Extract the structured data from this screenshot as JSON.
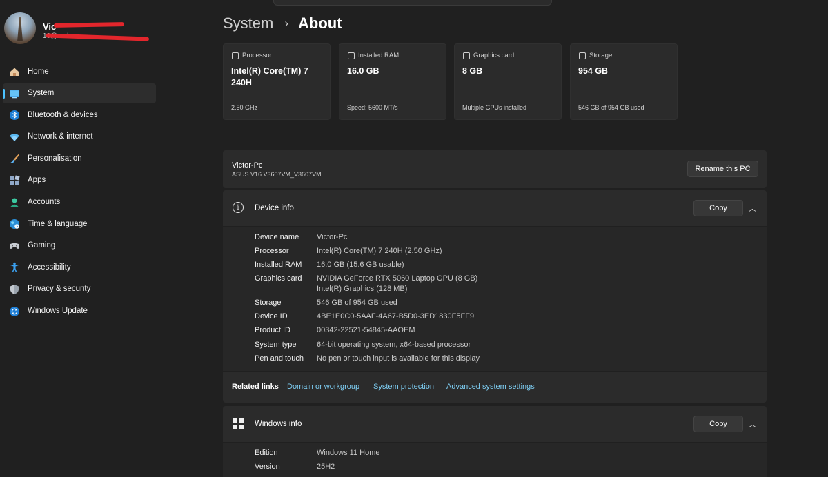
{
  "profile": {
    "name": "Vic",
    "email": "10@outlo"
  },
  "sidebar": {
    "items": [
      {
        "label": "Home",
        "icon": "home-icon",
        "active": false
      },
      {
        "label": "System",
        "icon": "system-icon",
        "active": true
      },
      {
        "label": "Bluetooth & devices",
        "icon": "bluetooth-icon",
        "active": false
      },
      {
        "label": "Network & internet",
        "icon": "wifi-icon",
        "active": false
      },
      {
        "label": "Personalisation",
        "icon": "brush-icon",
        "active": false
      },
      {
        "label": "Apps",
        "icon": "apps-icon",
        "active": false
      },
      {
        "label": "Accounts",
        "icon": "accounts-icon",
        "active": false
      },
      {
        "label": "Time & language",
        "icon": "globe-icon",
        "active": false
      },
      {
        "label": "Gaming",
        "icon": "gamepad-icon",
        "active": false
      },
      {
        "label": "Accessibility",
        "icon": "accessibility-icon",
        "active": false
      },
      {
        "label": "Privacy & security",
        "icon": "shield-icon",
        "active": false
      },
      {
        "label": "Windows Update",
        "icon": "update-icon",
        "active": false
      }
    ]
  },
  "breadcrumb": {
    "parent": "System",
    "separator": "›",
    "current": "About"
  },
  "cards": [
    {
      "label": "Processor",
      "value": "Intel(R) Core(TM) 7 240H",
      "sub": "2.50 GHz"
    },
    {
      "label": "Installed RAM",
      "value": "16.0 GB",
      "sub": "Speed: 5600 MT/s"
    },
    {
      "label": "Graphics card",
      "value": "8 GB",
      "sub": "Multiple GPUs installed"
    },
    {
      "label": "Storage",
      "value": "954 GB",
      "sub": "546 GB of 954 GB used"
    }
  ],
  "pc": {
    "name": "Victor-Pc",
    "model": "ASUS V16 V3607VM_V3607VM",
    "rename_label": "Rename this PC"
  },
  "device_info": {
    "title": "Device info",
    "copy_label": "Copy",
    "rows": [
      {
        "key": "Device name",
        "value": "Victor-Pc"
      },
      {
        "key": "Processor",
        "value": "Intel(R) Core(TM) 7 240H (2.50 GHz)"
      },
      {
        "key": "Installed RAM",
        "value": "16.0 GB (15.6 GB usable)"
      },
      {
        "key": "Graphics card",
        "value": "NVIDIA GeForce RTX 5060 Laptop GPU (8 GB)",
        "value2": "Intel(R) Graphics (128 MB)"
      },
      {
        "key": "Storage",
        "value": "546 GB of 954 GB used"
      },
      {
        "key": "Device ID",
        "value": "4BE1E0C0-5AAF-4A67-B5D0-3ED1830F5FF9"
      },
      {
        "key": "Product ID",
        "value": "00342-22521-54845-AAOEM"
      },
      {
        "key": "System type",
        "value": "64-bit operating system, x64-based processor"
      },
      {
        "key": "Pen and touch",
        "value": "No pen or touch input is available for this display"
      }
    ]
  },
  "related": {
    "label": "Related links",
    "links": [
      "Domain or workgroup",
      "System protection",
      "Advanced system settings"
    ]
  },
  "windows_info": {
    "title": "Windows info",
    "copy_label": "Copy",
    "rows": [
      {
        "key": "Edition",
        "value": "Windows 11 Home"
      },
      {
        "key": "Version",
        "value": "25H2"
      }
    ]
  },
  "colors": {
    "background": "#202020",
    "panel": "#2b2b2b",
    "accent": "#4cc2ff",
    "link": "#7fd0f6",
    "redaction": "#e3262c"
  }
}
